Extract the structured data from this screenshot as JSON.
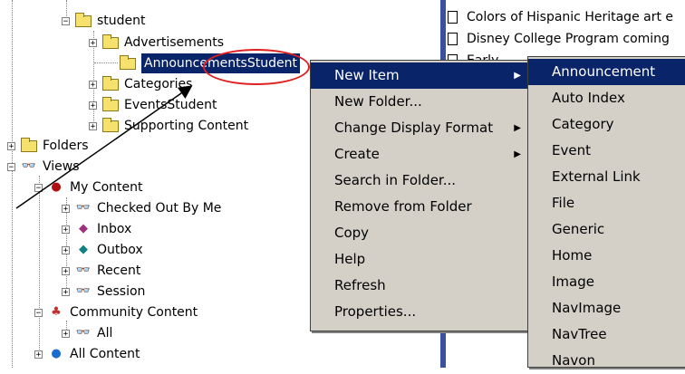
{
  "tree": {
    "student": "student",
    "advertisements": "Advertisements",
    "announcements_student": "AnnouncementsStudent",
    "categories": "Categories",
    "events_student": "EventsStudent",
    "supporting_content": "Supporting Content",
    "folders": "Folders",
    "views": "Views",
    "my_content": "My Content",
    "checked_out_by_me": "Checked Out By Me",
    "inbox": "Inbox",
    "outbox": "Outbox",
    "recent": "Recent",
    "session": "Session",
    "community_content": "Community Content",
    "all": "All",
    "all_content": "All Content"
  },
  "list": {
    "items": [
      "Colors of Hispanic Heritage art e",
      "Disney College Program coming",
      "Early"
    ]
  },
  "context_menu": {
    "items": [
      "New Item",
      "New Folder...",
      "Change Display Format",
      "Create",
      "Search in Folder...",
      "Remove from Folder",
      "Copy",
      "Help",
      "Refresh",
      "Properties..."
    ]
  },
  "submenu": {
    "items": [
      "Announcement",
      "Auto Index",
      "Category",
      "Event",
      "External Link",
      "File",
      "Generic",
      "Home",
      "Image",
      "NavImage",
      "NavTree",
      "Navon"
    ]
  },
  "colors": {
    "selection": "#0a246a",
    "menu_bg": "#d4d0c8",
    "annotation": "#e02020",
    "panel_border": "#3a50a0"
  }
}
